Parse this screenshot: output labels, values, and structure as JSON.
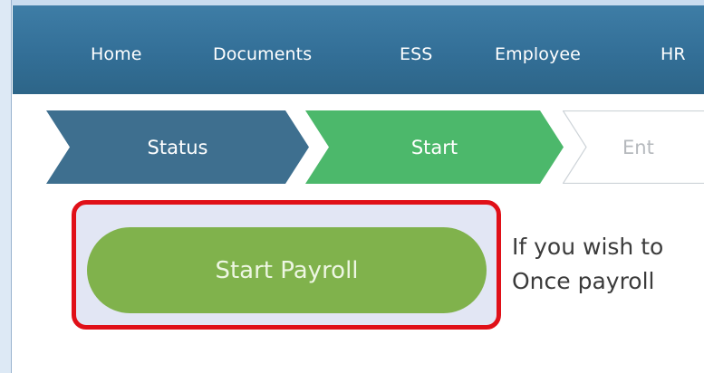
{
  "nav": {
    "items": [
      "Home",
      "Documents",
      "ESS",
      "Employee",
      "HR"
    ]
  },
  "steps": [
    {
      "label": "Status",
      "state": "completed",
      "color": "#3e6f8f"
    },
    {
      "label": "Start",
      "state": "current",
      "color": "#4cb86b"
    },
    {
      "label": "Ent",
      "state": "upcoming",
      "color": "#ffffff"
    }
  ],
  "action": {
    "start_label": "Start Payroll"
  },
  "info": {
    "line1": "If you wish to",
    "line2": "Once payroll"
  },
  "colors": {
    "navbar": "#336f97",
    "highlight_border": "#e01018",
    "button": "#80b24c"
  }
}
